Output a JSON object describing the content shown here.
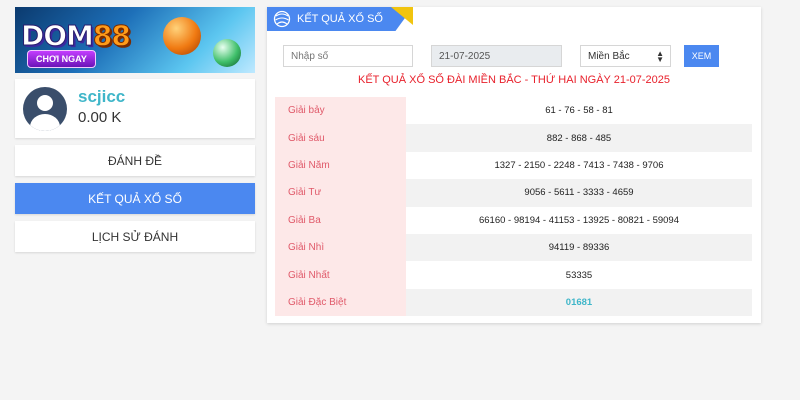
{
  "banner": {
    "logo_text": "DOM",
    "logo_num": "88",
    "cta": "CHƠI NGAY"
  },
  "user": {
    "name": "scjicc",
    "balance": "0.00 K"
  },
  "menu": {
    "danh_de": "ĐÁNH ĐỀ",
    "ket_qua": "KẾT QUẢ XỔ SỐ",
    "lich_su": "LỊCH SỬ ĐÁNH"
  },
  "panel": {
    "tab_label": "KẾT QUẢ XỔ SỐ",
    "search_placeholder": "Nhập số",
    "date_value": "21-07-2025",
    "region_selected": "Miền Bắc",
    "xem_label": "XEM",
    "result_title": "KẾT QUẢ XỔ SỐ ĐÀI MIỀN BẮC - THỨ HAI NGÀY 21-07-2025"
  },
  "results": [
    {
      "label": "Giải bảy",
      "value": "61 - 76 - 58 - 81"
    },
    {
      "label": "Giải sáu",
      "value": "882 - 868 - 485"
    },
    {
      "label": "Giải Năm",
      "value": "1327 - 2150 - 2248 - 7413 - 7438 - 9706"
    },
    {
      "label": "Giải Tư",
      "value": "9056 - 5611 - 3333 - 4659"
    },
    {
      "label": "Giải Ba",
      "value": "66160 - 98194 - 41153 - 13925 - 80821 - 59094"
    },
    {
      "label": "Giải Nhì",
      "value": "94119 - 89336"
    },
    {
      "label": "Giải Nhất",
      "value": "53335"
    },
    {
      "label": "Giải Đặc Biệt",
      "value": "01681"
    }
  ],
  "colors": {
    "accent": "#4b88f0",
    "title_red": "#e8212c",
    "label_pink": "#fde8e8",
    "teal": "#3fb6c9",
    "tab_stripe": "#f1c40f"
  },
  "icons": {
    "tab_icon": "lottery-ball-icon",
    "select_caret": "sort-caret-icon"
  }
}
